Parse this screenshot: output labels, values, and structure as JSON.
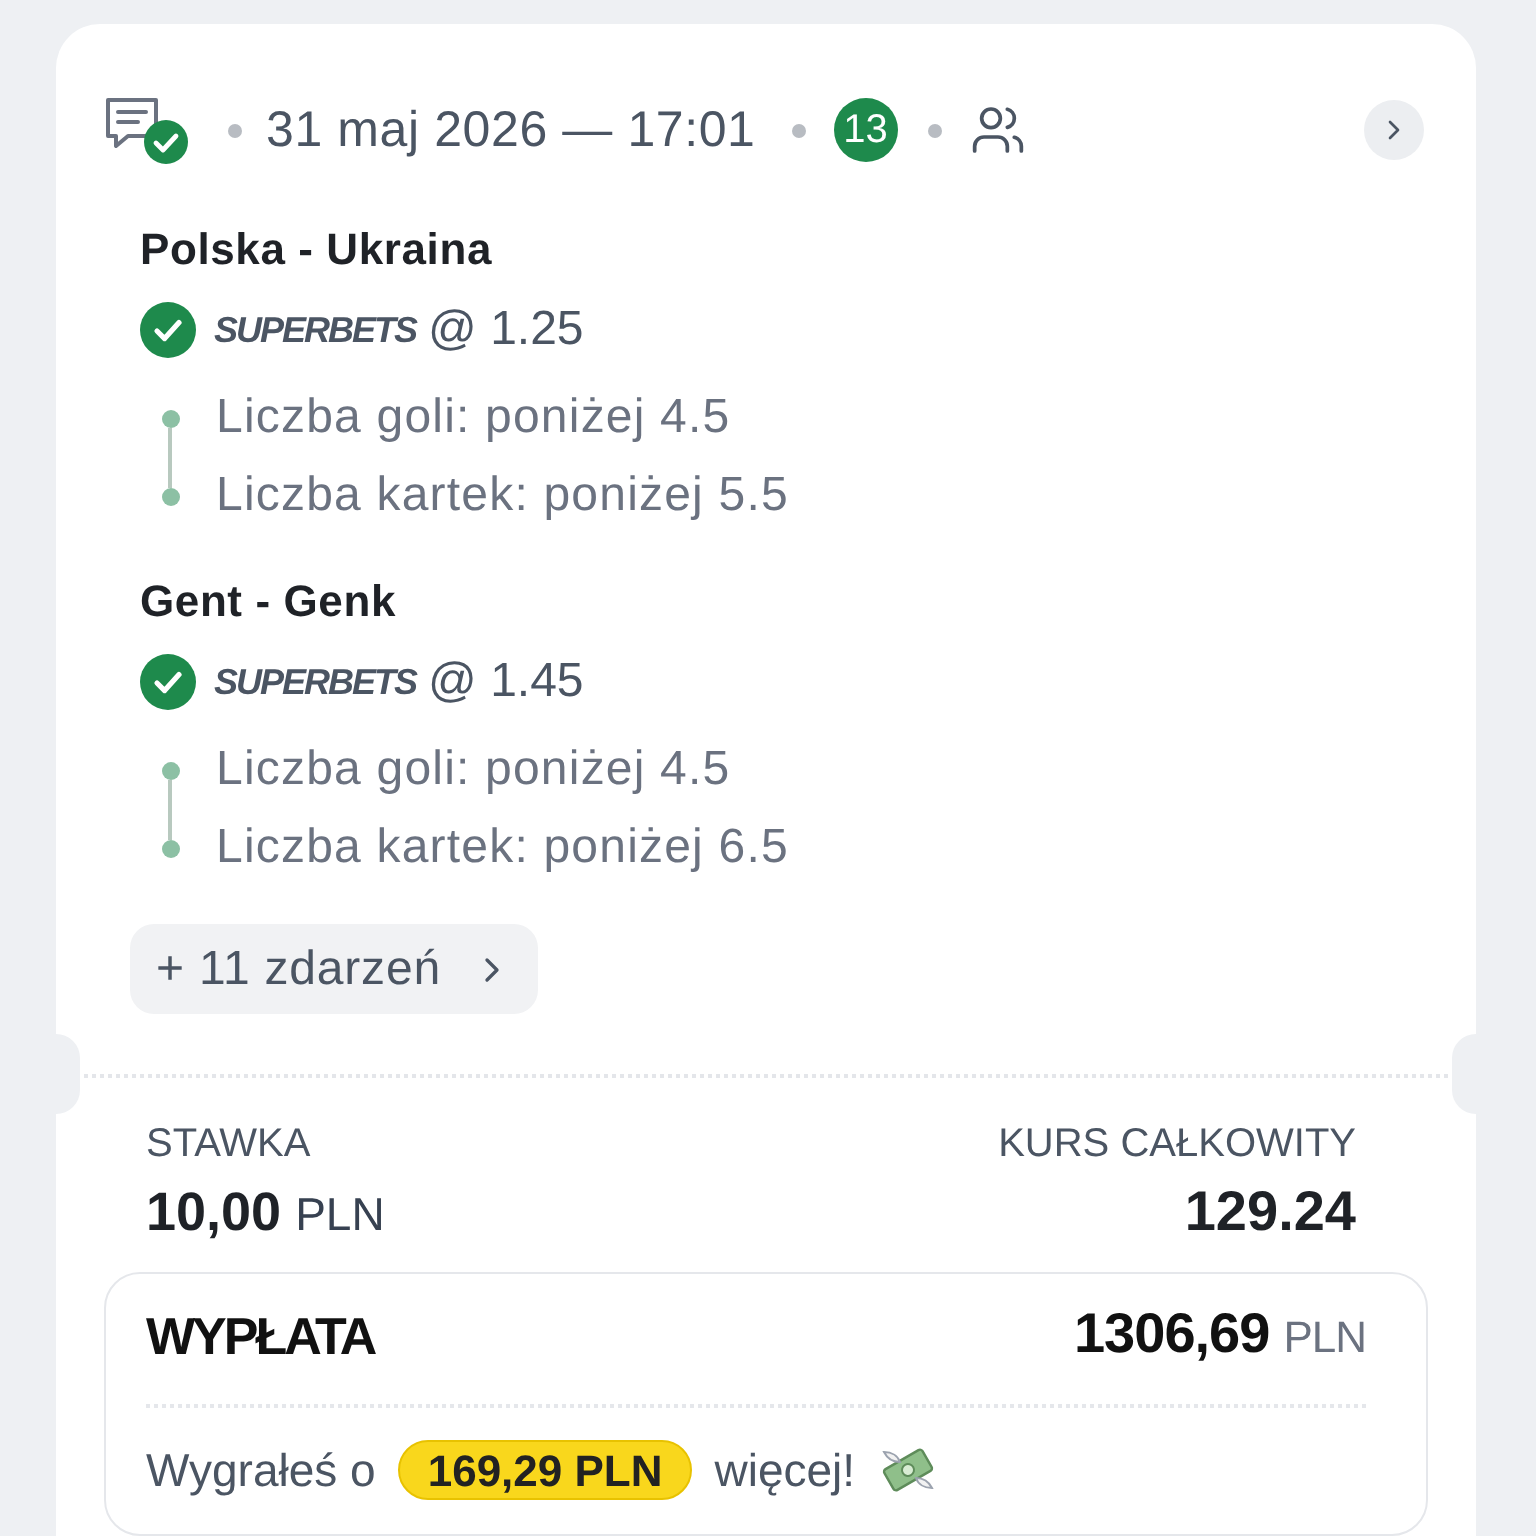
{
  "header": {
    "won": true,
    "date": "31 maj 2026 — 17:01",
    "count": "13"
  },
  "events": [
    {
      "title": "Polska - Ukraina",
      "won": true,
      "bookmaker": "SUPERBETS",
      "odds": "@ 1.25",
      "selections": [
        "Liczba goli: poniżej 4.5",
        "Liczba kartek: poniżej 5.5"
      ]
    },
    {
      "title": "Gent - Genk",
      "won": true,
      "bookmaker": "SUPERBETS",
      "odds": "@ 1.45",
      "selections": [
        "Liczba goli: poniżej 4.5",
        "Liczba kartek: poniżej 6.5"
      ]
    }
  ],
  "more_events": {
    "label": "+ 11 zdarzeń"
  },
  "stake": {
    "label": "STAWKA",
    "amount": "10,00",
    "currency": "PLN"
  },
  "total_odds": {
    "label": "KURS CAŁKOWITY",
    "value": "129.24"
  },
  "payout": {
    "label": "WYPŁATA",
    "amount": "1306,69",
    "currency": "PLN",
    "message": {
      "before": "Wygrałeś o",
      "highlight": "169,29 PLN",
      "after": "więcej!"
    }
  }
}
